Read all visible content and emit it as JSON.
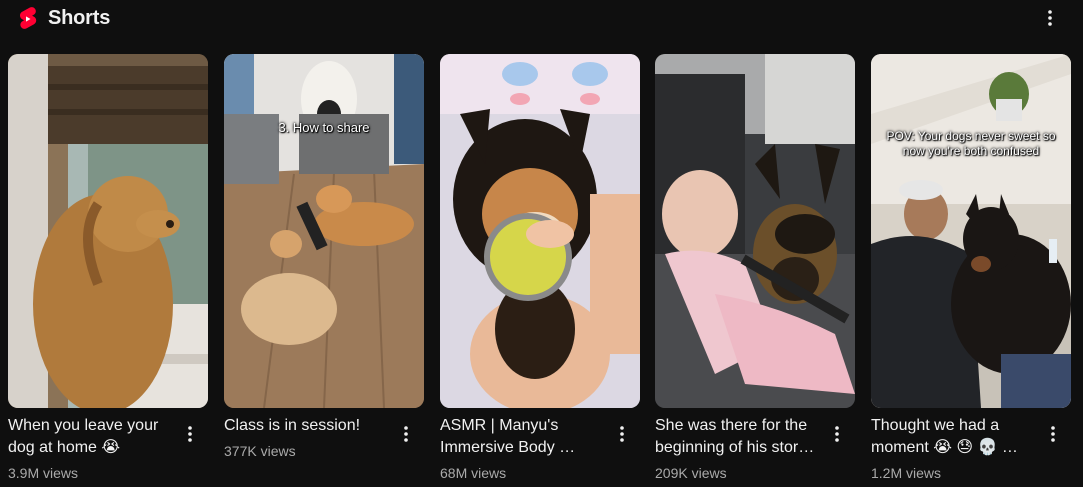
{
  "header": {
    "title": "Shorts",
    "logo_icon": "youtube-shorts-icon",
    "menu_icon": "more-vert-icon",
    "brand_color": "#ff0033"
  },
  "shorts": [
    {
      "title": "When you leave your dog at home 😭",
      "views": "3.9M views",
      "overlay": ""
    },
    {
      "title": "Class is in session!",
      "views": "377K views",
      "overlay": "3. How to share"
    },
    {
      "title": "ASMR | Manyu's Immersive Body …",
      "views": "68M views",
      "overlay": ""
    },
    {
      "title": "She was there for the beginning of his stor…",
      "views": "209K views",
      "overlay": ""
    },
    {
      "title": "Thought we had a moment 😭 😓 💀 …",
      "views": "1.2M views",
      "overlay": "POV: Your dogs never sweet so now you're both confused"
    }
  ]
}
